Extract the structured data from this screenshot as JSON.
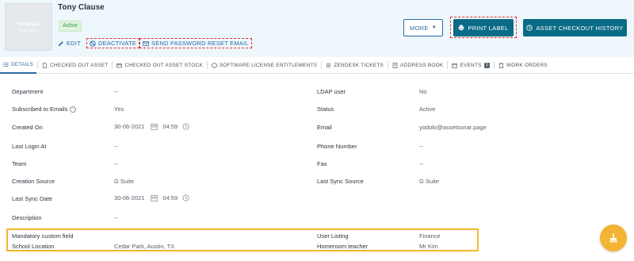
{
  "user": {
    "name": "Tony Clause",
    "status": "Active",
    "avatar_line1": "NO IMAGE",
    "avatar_line2": "AVAILABLE"
  },
  "actions": {
    "edit": "EDIT",
    "deactivate": "DEACTIVATE",
    "reset_password": "SEND PASSWORD RESET EMAIL"
  },
  "buttons": {
    "more": "MORE",
    "print_label": "PRINT LABEL",
    "checkout_history": "ASSET CHECKOUT HISTORY"
  },
  "tabs": [
    {
      "label": "DETAILS",
      "icon": "list-icon"
    },
    {
      "label": "CHECKED OUT ASSET",
      "icon": "file-icon"
    },
    {
      "label": "CHECKED OUT ASSET STOCK",
      "icon": "box-icon"
    },
    {
      "label": "SOFTWARE LICENSE ENTITLEMENTS",
      "icon": "cube-icon"
    },
    {
      "label": "ZENDESK TICKETS",
      "icon": "ticket-icon"
    },
    {
      "label": "ADDRESS BOOK",
      "icon": "book-icon"
    },
    {
      "label": "EVENTS",
      "icon": "calendar-icon",
      "badge": "1"
    },
    {
      "label": "WORK ORDERS",
      "icon": "clipboard-icon"
    }
  ],
  "fields_left": [
    {
      "label": "Department",
      "value": "--"
    },
    {
      "label": "Subscribed to Emails",
      "value": "Yes"
    },
    {
      "label": "Created On",
      "date": "30-06-2021",
      "time": "04:59"
    },
    {
      "label": "Last Login At",
      "value": "--"
    },
    {
      "label": "Team",
      "value": "--"
    },
    {
      "label": "Creation Source",
      "value": "G Suite"
    },
    {
      "label": "Last Sync Date",
      "date": "30-06-2021",
      "time": "04:59"
    },
    {
      "label": "Description",
      "value": "--"
    }
  ],
  "fields_right": [
    {
      "label": "LDAP user",
      "value": "No"
    },
    {
      "label": "Status",
      "value": "Active"
    },
    {
      "label": "Email",
      "value": "yodolo@assetsonar.page"
    },
    {
      "label": "Phone Number",
      "value": "--"
    },
    {
      "label": "Fax",
      "value": "--"
    },
    {
      "label": "Last Sync Source",
      "value": "G Suite"
    }
  ],
  "custom_fields": {
    "mandatory_label": "Mandatory custom field",
    "mandatory_value": "",
    "school_label": "School Location",
    "school_value": "Cedar Park, Austin, TX",
    "user_listing_label": "User Listing",
    "user_listing_value": "Finance",
    "homeroom_label": "Homeroom teacher",
    "homeroom_value": "Mr Kim"
  },
  "colors": {
    "accent": "#0a6b86",
    "link": "#2d6aa5",
    "highlight": "#f1b72d",
    "fab": "#f4b433",
    "header_bg": "#eef8fc"
  }
}
